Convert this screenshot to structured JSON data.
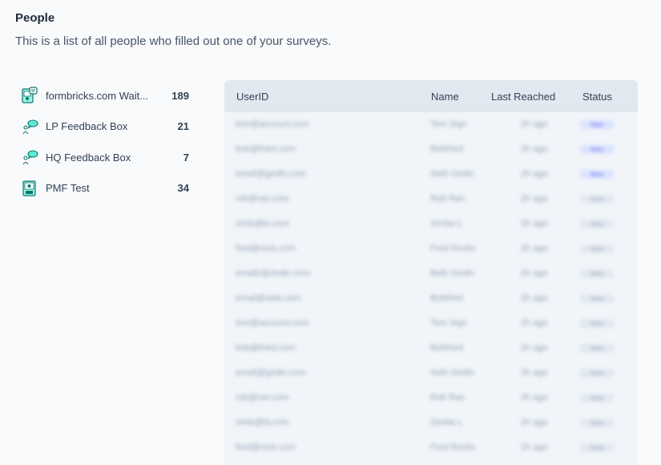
{
  "header": {
    "title": "People",
    "subtitle": "This is a list of all people who filled out one of your surveys."
  },
  "surveys": [
    {
      "label": "formbricks.com Wait...",
      "count": "189",
      "icon": "waitlist-form-icon"
    },
    {
      "label": "LP Feedback Box",
      "count": "21",
      "icon": "feedback-bubble-icon"
    },
    {
      "label": "HQ Feedback Box",
      "count": "7",
      "icon": "feedback-bubble-icon"
    },
    {
      "label": "PMF Test",
      "count": "34",
      "icon": "pmf-survey-icon"
    }
  ],
  "table": {
    "columns": {
      "userid": "UserID",
      "name": "Name",
      "last_reached": "Last Reached",
      "status": "Status"
    },
    "rows": [
      {
        "userid": "tom@account.com",
        "name": "Tom Sign",
        "last_reached": "2h ago",
        "status": "New",
        "status_type": "new"
      },
      {
        "userid": "bob@fried.com",
        "name": "Bobfried",
        "last_reached": "2h ago",
        "status": "New",
        "status_type": "new"
      },
      {
        "userid": "email@godin.com",
        "name": "Seth Godin",
        "last_reached": "2h ago",
        "status": "New",
        "status_type": "new"
      },
      {
        "userid": "rob@ran.com",
        "name": "Rob Ran",
        "last_reached": "2h ago",
        "status": "New",
        "status_type": "old"
      },
      {
        "userid": "simb@la.com",
        "name": "Simba L",
        "last_reached": "2h ago",
        "status": "New",
        "status_type": "old"
      },
      {
        "userid": "fred@rock.com",
        "name": "Fred Rocks",
        "last_reached": "2h ago",
        "status": "New",
        "status_type": "old"
      },
      {
        "userid": "emails@dodin.com",
        "name": "Beth Godin",
        "last_reached": "2h ago",
        "status": "New",
        "status_type": "old"
      },
      {
        "userid": "email@web.com",
        "name": "Bobfried",
        "last_reached": "2h ago",
        "status": "New",
        "status_type": "old"
      },
      {
        "userid": "tom@account.com",
        "name": "Tom Sign",
        "last_reached": "2h ago",
        "status": "New",
        "status_type": "old"
      },
      {
        "userid": "bob@fried.com",
        "name": "Bobfried",
        "last_reached": "2h ago",
        "status": "New",
        "status_type": "old"
      },
      {
        "userid": "email@godin.com",
        "name": "Seth Godin",
        "last_reached": "2h ago",
        "status": "New",
        "status_type": "old"
      },
      {
        "userid": "rob@ran.com",
        "name": "Rob Ran",
        "last_reached": "2h ago",
        "status": "New",
        "status_type": "old"
      },
      {
        "userid": "simb@la.com",
        "name": "Simba L",
        "last_reached": "2h ago",
        "status": "New",
        "status_type": "old"
      },
      {
        "userid": "fred@rock.com",
        "name": "Fred Rocks",
        "last_reached": "2h ago",
        "status": "New",
        "status_type": "old"
      }
    ]
  },
  "colors": {
    "accent": "#14b8a6",
    "badge_new": "#dbe2ff",
    "badge_old": "#e2e8f0"
  }
}
